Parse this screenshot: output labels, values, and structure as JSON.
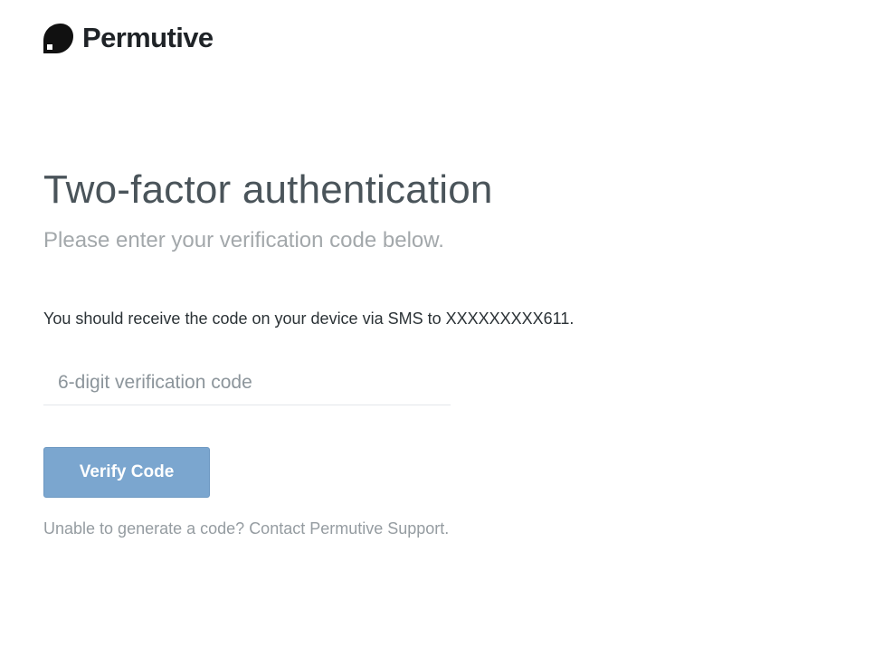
{
  "brand": {
    "name": "Permutive",
    "logo_icon": "permutive-logo-icon",
    "color": "#111111"
  },
  "auth": {
    "title": "Two-factor authentication",
    "subtitle": "Please enter your verification code below.",
    "sms_note": "You should receive the code on your device via SMS to XXXXXXXXX611.",
    "code_input": {
      "value": "",
      "placeholder": "6-digit verification code"
    },
    "verify_button_label": "Verify Code",
    "help_prefix": "Unable to generate a code?",
    "help_link_label": "Contact Permutive Support."
  },
  "colors": {
    "accent": "#7ba6cf",
    "title_text": "#4a545a",
    "muted_text": "#a3a8ab"
  }
}
